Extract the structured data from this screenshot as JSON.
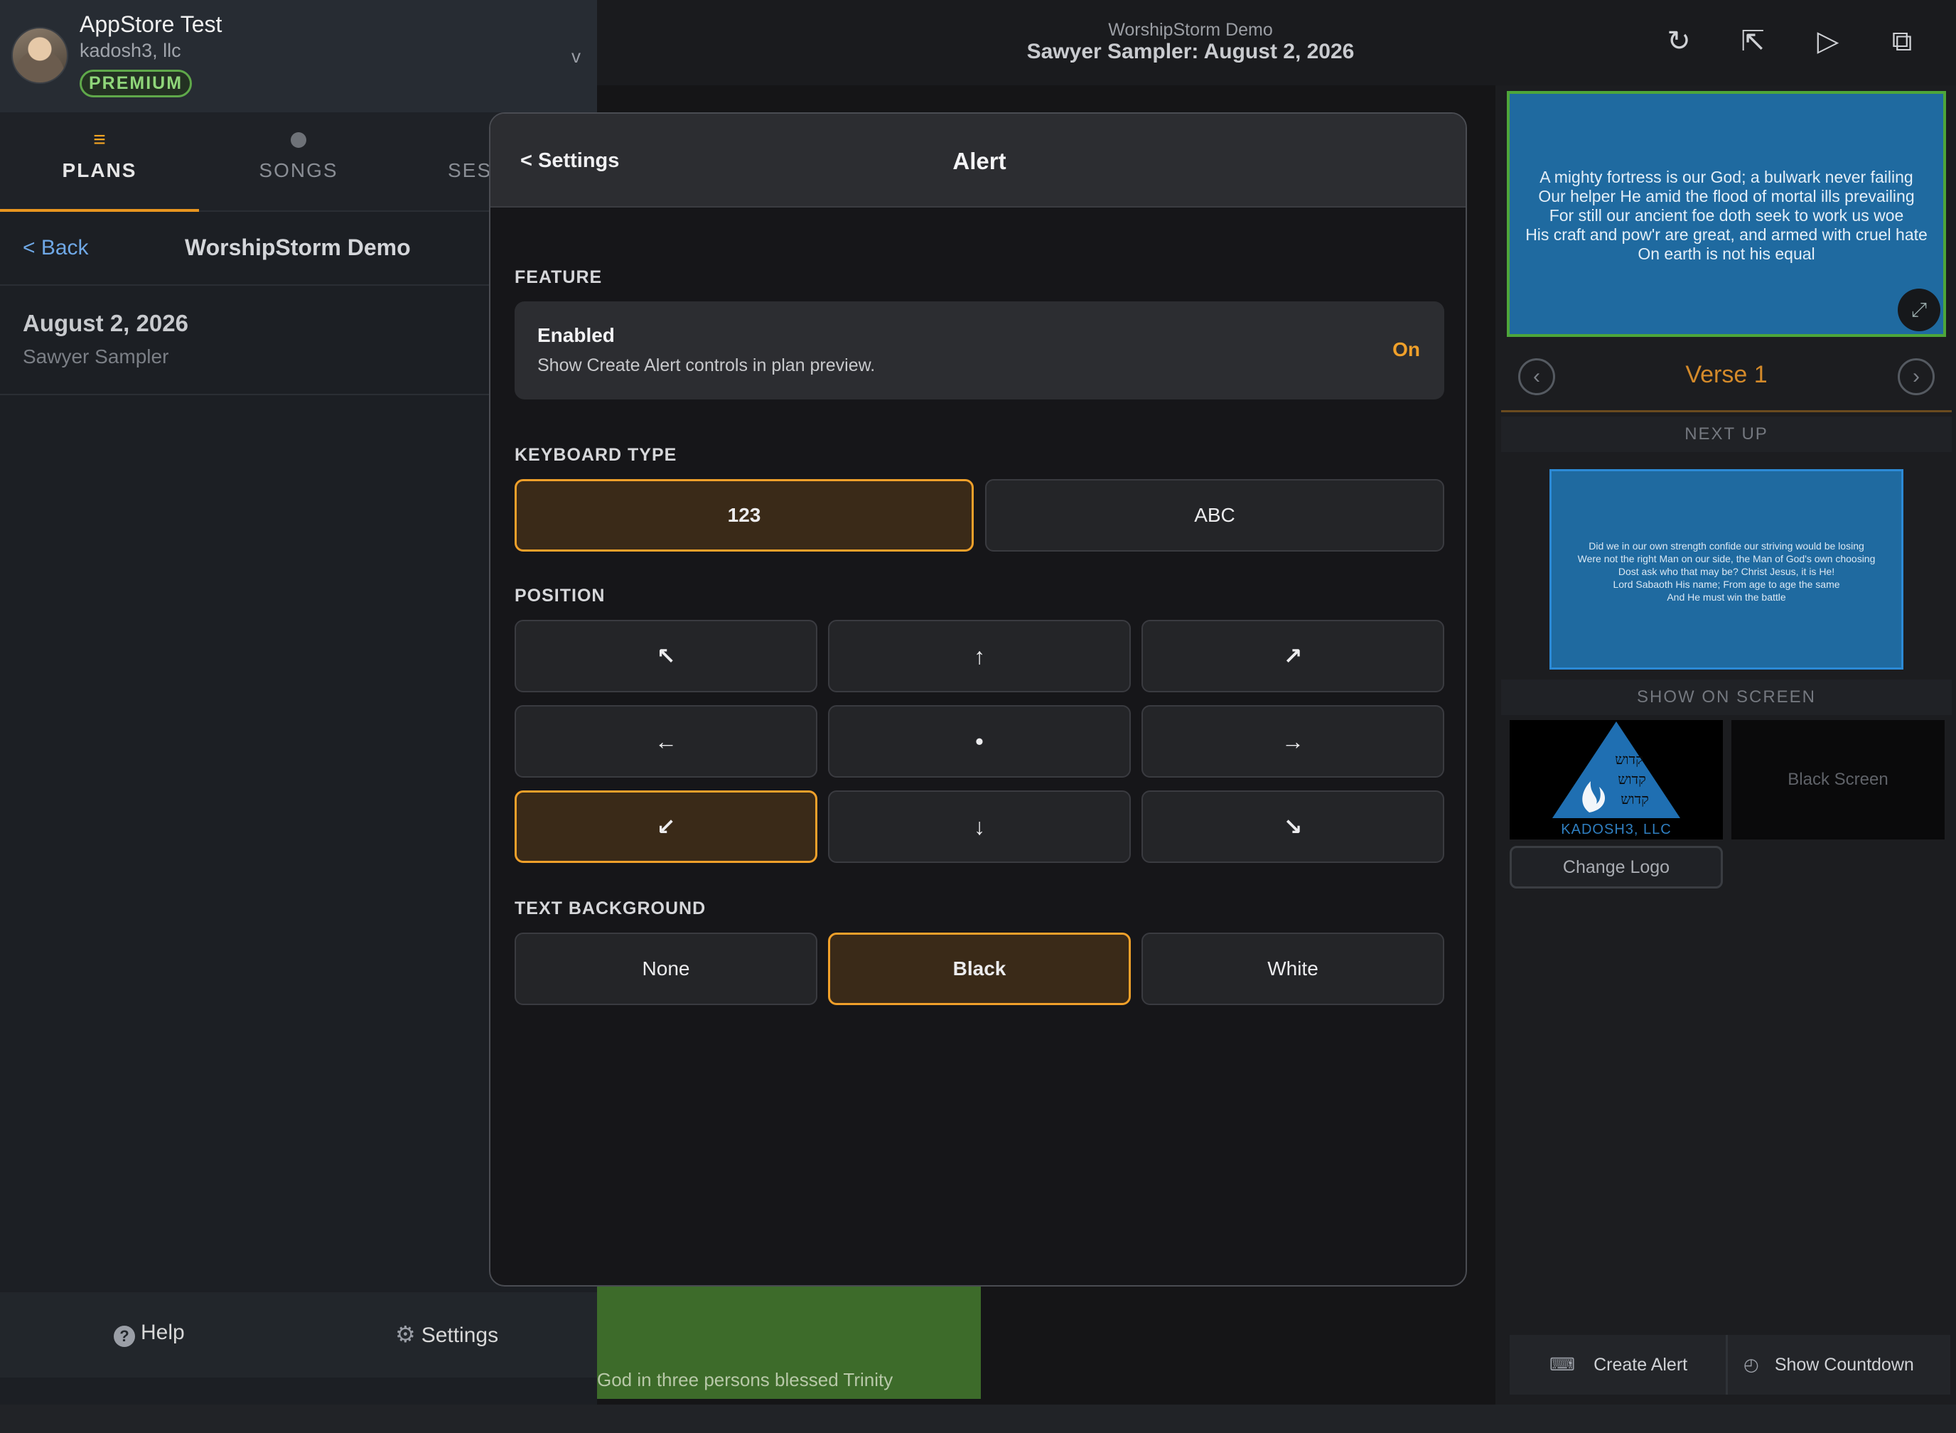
{
  "account": {
    "name": "AppStore Test",
    "org": "kadosh3, llc",
    "badge": "PREMIUM",
    "chevron": "v"
  },
  "sidebar": {
    "tabs": [
      {
        "label": "PLANS",
        "icon": "≡"
      },
      {
        "label": "SONGS",
        "icon": "●"
      },
      {
        "label": "SESS",
        "icon": ""
      }
    ],
    "back_label": "< Back",
    "plan_title": "WorshipStorm Demo",
    "plan": {
      "date": "August 2, 2026",
      "name": "Sawyer Sampler"
    },
    "footer": {
      "help": "Help",
      "help_icon": "?",
      "settings": "Settings",
      "settings_icon": "⚙"
    }
  },
  "header": {
    "subtitle": "WorshipStorm Demo",
    "title": "Sawyer Sampler: August 2, 2026",
    "icons": {
      "refresh": "↻",
      "export": "⇱",
      "play": "▷",
      "screen": "⧉"
    }
  },
  "modal": {
    "back_label": "< Settings",
    "title": "Alert",
    "feature": {
      "section": "FEATURE",
      "name": "Enabled",
      "description": "Show Create Alert controls in plan preview.",
      "state": "On"
    },
    "keyboard": {
      "section": "KEYBOARD TYPE",
      "options": [
        "123",
        "ABC"
      ],
      "selected": "123"
    },
    "position": {
      "section": "POSITION",
      "arrows": [
        "↖",
        "↑",
        "↗",
        "←",
        "•",
        "→",
        "↙",
        "↓",
        "↘"
      ],
      "selected_index": 6
    },
    "text_background": {
      "section": "TEXT BACKGROUND",
      "options": [
        "None",
        "Black",
        "White"
      ],
      "selected": "Black"
    }
  },
  "right_panel": {
    "preview_lines": [
      "A mighty fortress is our God; a bulwark never failing",
      "Our helper He amid the flood of mortal ills prevailing",
      "For still our ancient foe doth seek to work us woe",
      "His craft and pow'r are great, and armed with cruel hate",
      "On earth is not his equal"
    ],
    "verse_label": "Verse 1",
    "prev_icon": "‹",
    "next_icon": "›",
    "expand_icon": "⤢",
    "next_up_label": "NEXT UP",
    "next_lines": [
      "Did we in our own strength confide our striving would be losing",
      "Were not the right Man on our side, the Man of God's own choosing",
      "Dost ask who that may be? Christ Jesus, it is He!",
      "Lord Sabaoth His name; From age to age the same",
      "And He must win the battle"
    ],
    "show_on_screen_label": "SHOW ON SCREEN",
    "logo_caption": "KADOSH3, LLC",
    "logo_glyphs": "קדוש",
    "black_screen": "Black Screen",
    "change_logo": "Change Logo",
    "create_alert": "Create Alert",
    "create_alert_icon": "⌨",
    "show_countdown": "Show Countdown",
    "countdown_icon": "◴"
  },
  "background": {
    "song_line": "God in three persons blessed Trinity"
  },
  "colors": {
    "accent": "#f0a02a",
    "premium": "#8fd67a",
    "slide_blue": "#1f6aa0",
    "link": "#6fa8e6"
  }
}
